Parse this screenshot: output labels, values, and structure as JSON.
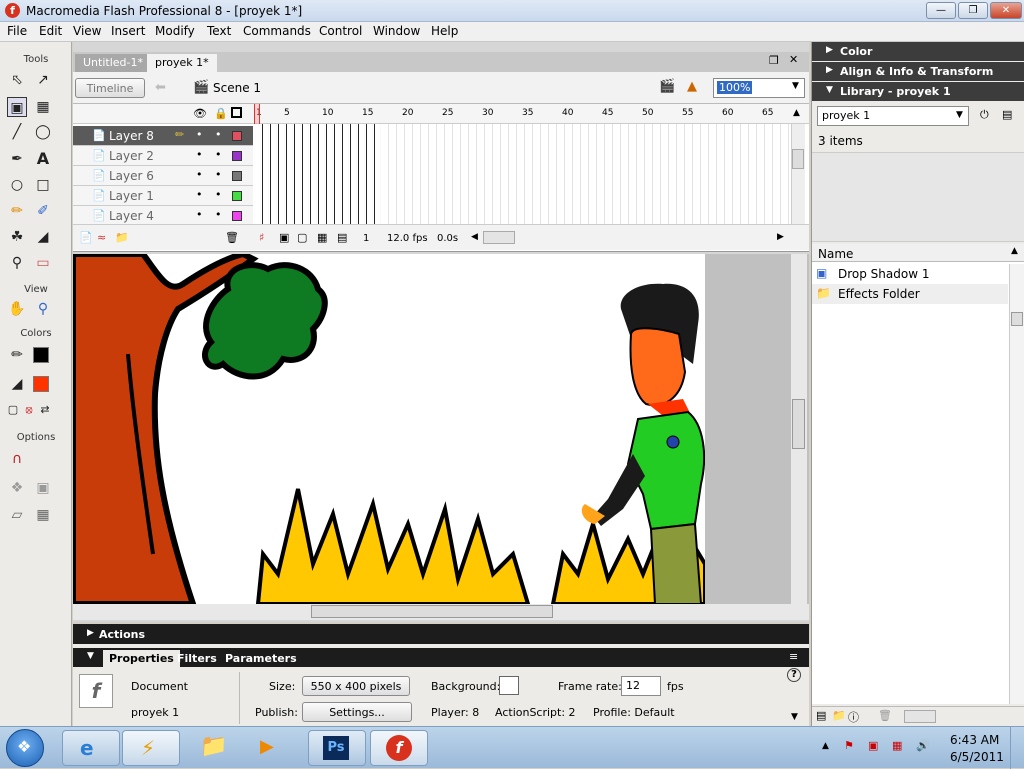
{
  "window": {
    "title": "Macromedia Flash Professional 8 - [proyek 1*]"
  },
  "menu": [
    "File",
    "Edit",
    "View",
    "Insert",
    "Modify",
    "Text",
    "Commands",
    "Control",
    "Window",
    "Help"
  ],
  "tools": {
    "header": "Tools",
    "view": "View",
    "colors": "Colors",
    "options": "Options",
    "stroke_color": "#000000",
    "fill_color": "#ff3300"
  },
  "tabs": [
    {
      "label": "Untitled-1*"
    },
    {
      "label": "proyek 1*"
    }
  ],
  "editbar": {
    "timeline_button": "Timeline",
    "scene": "Scene 1",
    "zoom": "100%"
  },
  "timeline": {
    "ruler": [
      "1",
      "5",
      "10",
      "15",
      "20",
      "25",
      "30",
      "35",
      "40",
      "45",
      "50",
      "55",
      "60",
      "65"
    ],
    "layers": [
      {
        "name": "Layer 8",
        "color": "#e05060"
      },
      {
        "name": "Layer 2",
        "color": "#9933cc"
      },
      {
        "name": "Layer 6",
        "color": "#777777"
      },
      {
        "name": "Layer 1",
        "color": "#44dd44"
      },
      {
        "name": "Layer 4",
        "color": "#ee44ee"
      }
    ],
    "frame": "1",
    "fps": "12.0 fps",
    "time": "0.0s"
  },
  "right_panels": {
    "color": "Color",
    "align": "Align & Info & Transform",
    "library": "Library - proyek 1",
    "library_select": "proyek 1",
    "item_count": "3 items",
    "column_name": "Name",
    "items": [
      {
        "name": "Drop Shadow 1",
        "icon": "symbol-icon"
      },
      {
        "name": "Effects Folder",
        "icon": "folder-icon"
      }
    ]
  },
  "actions_panel": {
    "label": "Actions"
  },
  "properties": {
    "tabs": [
      "Properties",
      "Filters",
      "Parameters"
    ],
    "doc_label": "Document",
    "doc_name": "proyek 1",
    "size_label": "Size:",
    "size_value": "550 x 400 pixels",
    "background_label": "Background:",
    "background_color": "#ffffff",
    "framerate_label": "Frame rate:",
    "framerate_value": "12",
    "fps_unit": "fps",
    "publish_label": "Publish:",
    "settings_button": "Settings...",
    "player": "Player: 8",
    "actionscript": "ActionScript:  2",
    "profile": "Profile:  Default"
  },
  "taskbar": {
    "time": "6:43 AM",
    "date": "6/5/2011"
  }
}
